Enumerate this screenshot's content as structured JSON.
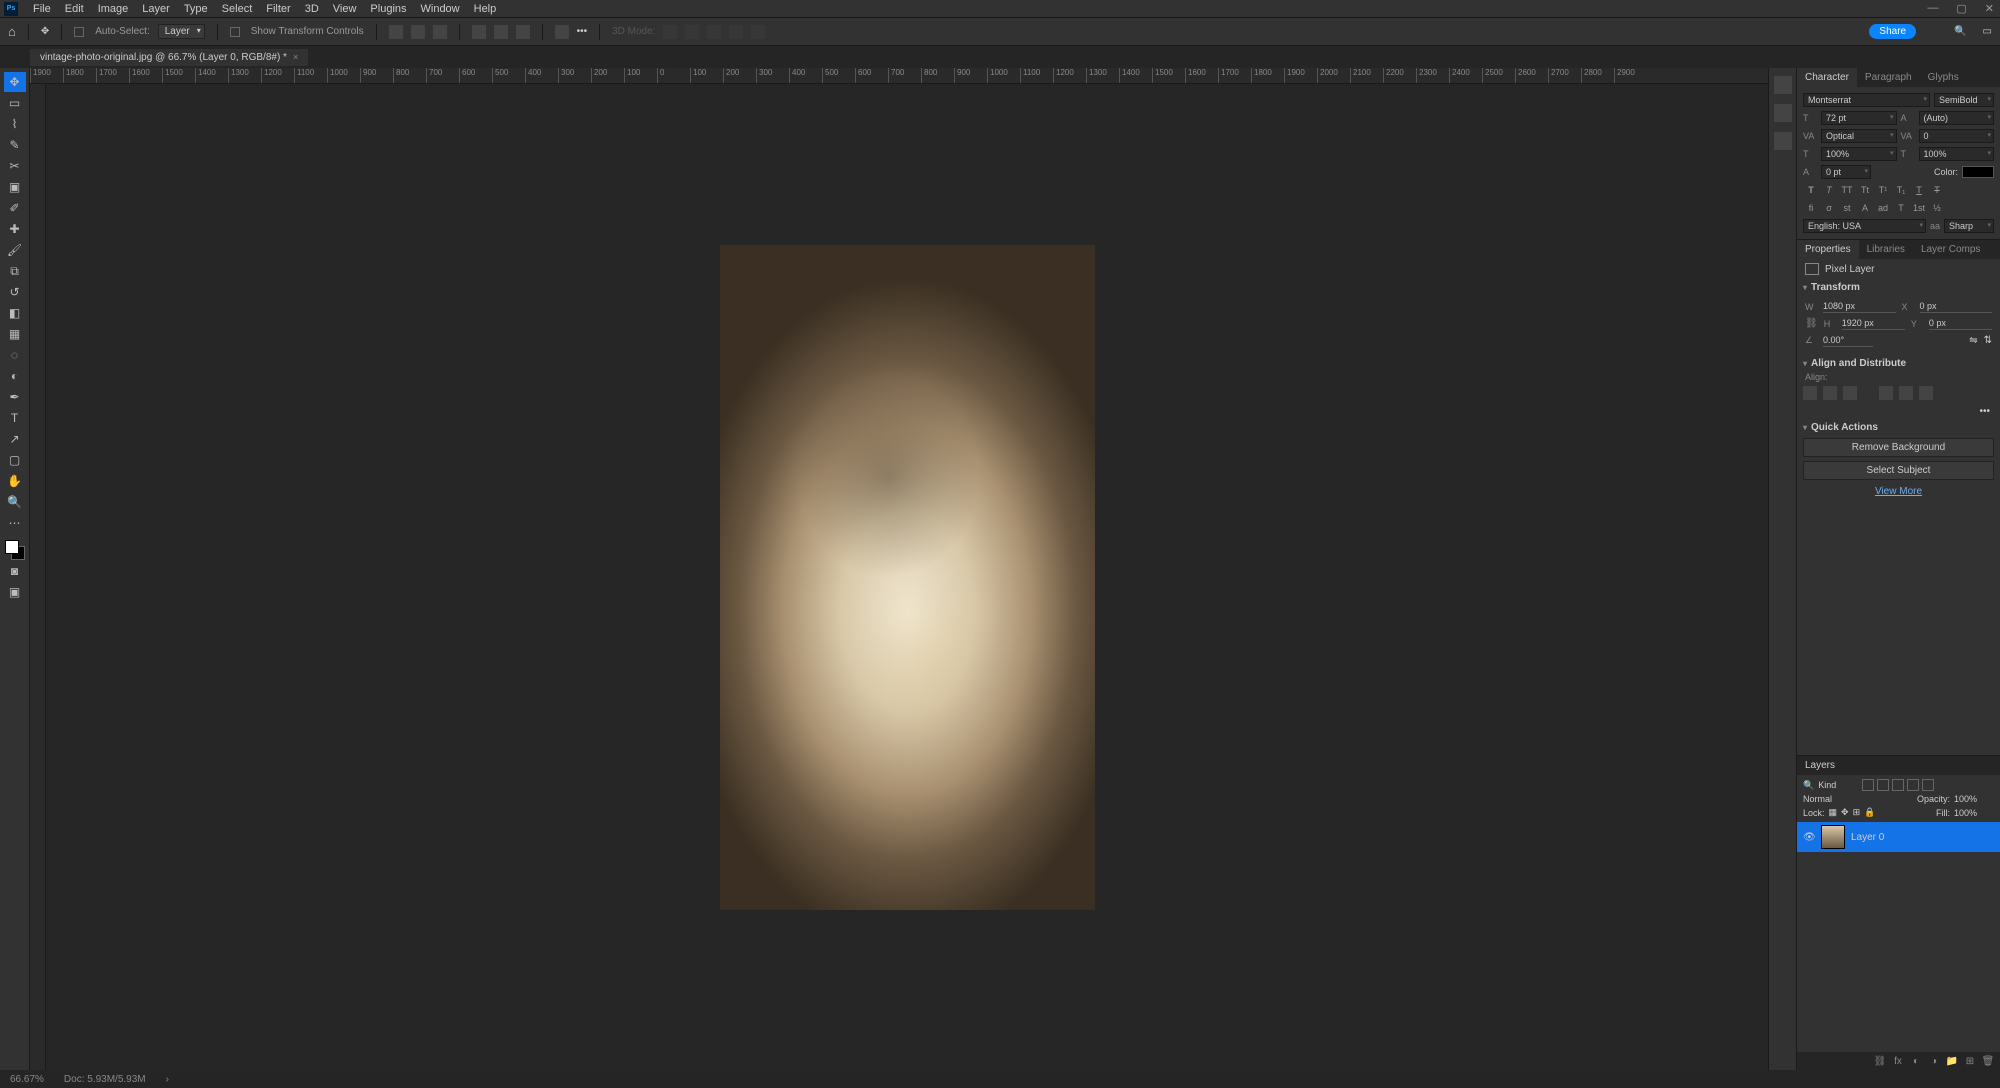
{
  "menu": [
    "File",
    "Edit",
    "Image",
    "Layer",
    "Type",
    "Select",
    "Filter",
    "3D",
    "View",
    "Plugins",
    "Window",
    "Help"
  ],
  "optbar": {
    "auto_select": "Auto-Select:",
    "layer_dd": "Layer",
    "show_transform": "Show Transform Controls",
    "mode3d": "3D Mode:"
  },
  "share": "Share",
  "tab": {
    "title": "vintage-photo-original.jpg @ 66.7% (Layer 0, RGB/8#) *"
  },
  "ruler_h": [
    "1900",
    "1800",
    "1700",
    "1600",
    "1500",
    "1400",
    "1300",
    "1200",
    "1100",
    "1000",
    "900",
    "800",
    "700",
    "600",
    "500",
    "400",
    "300",
    "200",
    "100",
    "0",
    "100",
    "200",
    "300",
    "400",
    "500",
    "600",
    "700",
    "800",
    "900",
    "1000",
    "1100",
    "1200",
    "1300",
    "1400",
    "1500",
    "1600",
    "1700",
    "1800",
    "1900",
    "2000",
    "2100",
    "2200",
    "2300",
    "2400",
    "2500",
    "2600",
    "2700",
    "2800",
    "2900"
  ],
  "charTabs": [
    "Character",
    "Paragraph",
    "Glyphs"
  ],
  "char": {
    "font": "Montserrat",
    "style": "SemiBold",
    "size": "72 pt",
    "leading": "(Auto)",
    "kerning": "Optical",
    "tracking": "0",
    "vscale": "100%",
    "hscale": "100%",
    "baseline": "0 pt",
    "color_lbl": "Color:",
    "lang": "English: USA",
    "aa": "Sharp",
    "aa_lbl": "aa"
  },
  "propTabs": [
    "Properties",
    "Libraries",
    "Layer Comps"
  ],
  "prop": {
    "pixel_layer": "Pixel Layer",
    "transform": "Transform",
    "w": "1080 px",
    "h": "1920 px",
    "x": "0 px",
    "y": "0 px",
    "angle": "0.00°",
    "w_lbl": "W",
    "h_lbl": "H",
    "x_lbl": "X",
    "y_lbl": "Y",
    "align_hdr": "Align and Distribute",
    "align_lbl": "Align:",
    "qa_hdr": "Quick Actions",
    "qa1": "Remove Background",
    "qa2": "Select Subject",
    "view_more": "View More"
  },
  "layers": {
    "hdr": "Layers",
    "kind": "Kind",
    "blend": "Normal",
    "opacity_lbl": "Opacity:",
    "opacity": "100%",
    "lock_lbl": "Lock:",
    "fill_lbl": "Fill:",
    "fill": "100%",
    "layer0": "Layer 0"
  },
  "status": {
    "zoom": "66.67%",
    "doc": "Doc: 5.93M/5.93M"
  }
}
